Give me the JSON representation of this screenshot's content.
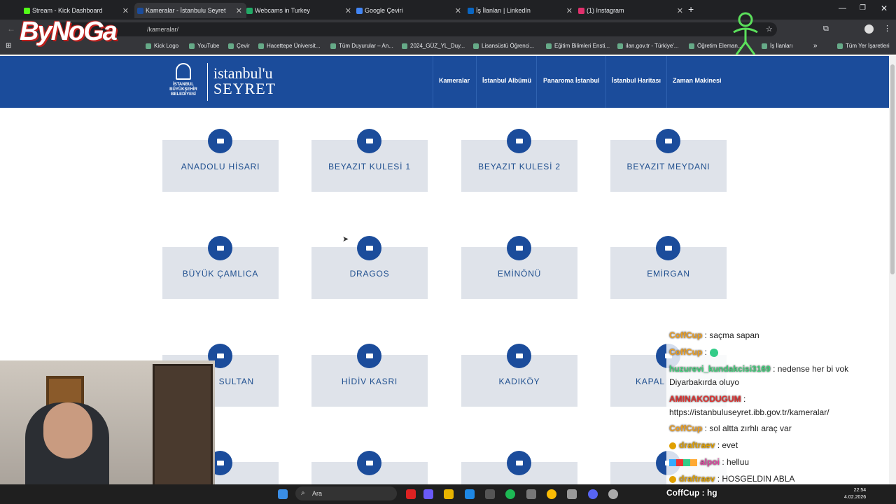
{
  "browser": {
    "tabs": [
      {
        "label": "Stream - Kick Dashboard",
        "color": "#53fc18"
      },
      {
        "label": "Kameralar - İstanbulu Seyret",
        "color": "#1b4c9b"
      },
      {
        "label": "Webcams in Turkey",
        "color": "#2a6"
      },
      {
        "label": "Google Çeviri",
        "color": "#4285f4"
      },
      {
        "label": "İş İlanları | LinkedIn",
        "color": "#0a66c2"
      },
      {
        "label": "(1) Instagram",
        "color": "#e1306c"
      }
    ],
    "address": "/kameralar/",
    "bookmarks": [
      {
        "label": "Kick Logo"
      },
      {
        "label": "YouTube"
      },
      {
        "label": "Çevir"
      },
      {
        "label": "Hacettepe Üniversit..."
      },
      {
        "label": "Tüm Duyurular – An..."
      },
      {
        "label": "2024_GÜZ_YL_Duy..."
      },
      {
        "label": "Lisansüstü Öğrenci..."
      },
      {
        "label": "Eğitim Bilimleri Ensti..."
      },
      {
        "label": "ilan.gov.tr - Türkiye'..."
      },
      {
        "label": "Öğretim Eleman..."
      },
      {
        "label": "İş İlanları"
      },
      {
        "label": "Tüm Yer İşaretleri"
      }
    ]
  },
  "site": {
    "logo_line1": "istanbul'u",
    "logo_line2": "SEYRET",
    "emblem_text": "İSTANBUL BÜYÜKŞEHİR BELEDİYESİ",
    "nav": [
      "Kameralar",
      "İstanbul Albümü",
      "Panaroma İstanbul",
      "İstanbul Haritası",
      "Zaman Makinesi"
    ],
    "cameras": [
      "ANADOLU HİSARI",
      "BEYAZIT KULESİ 1",
      "BEYAZIT KULESİ 2",
      "BEYAZIT MEYDANI",
      "BÜYÜK ÇAMLICA",
      "DRAGOS",
      "EMİNÖNÜ",
      "EMİRGAN",
      "SULTAN",
      "HİDİV KASRI",
      "KADIKÖY",
      "KAPAL"
    ]
  },
  "overlay": {
    "brand": "ByNoGa",
    "chat": [
      {
        "user": "CoffCup",
        "text": " : saçma sapan",
        "color": "#f0a020"
      },
      {
        "user": "CoffCup",
        "text": " :",
        "color": "#f0a020"
      },
      {
        "user": "huzurevi_kundakcisi3169",
        "text": " : nedense her bi vok",
        "color": "#3fd07a"
      },
      {
        "user": "",
        "text": "Diyarbakırda oluyo",
        "color": "#222"
      },
      {
        "user": "AMINAKODUGUM",
        "text": " :",
        "color": "#e03030"
      },
      {
        "user": "",
        "text": "https://istanbuluseyret.ibb.gov.tr/kameralar/",
        "color": "#222"
      },
      {
        "user": "CoffCup",
        "text": " : sol altta zırhlı araç var",
        "color": "#f0a020"
      },
      {
        "user": "draftraev",
        "text": " : evet",
        "color": "#e0a000"
      },
      {
        "user": "alpoi",
        "text": " : helluu",
        "color": "#e040a0"
      },
      {
        "user": "draftraev",
        "text": " : HOSGELDIN ABLA",
        "color": "#e0a000"
      }
    ],
    "chat_bottom": "CoffCup : hg"
  },
  "taskbar": {
    "search": "Ara",
    "time": "22:54",
    "date": "4.02.2026"
  }
}
